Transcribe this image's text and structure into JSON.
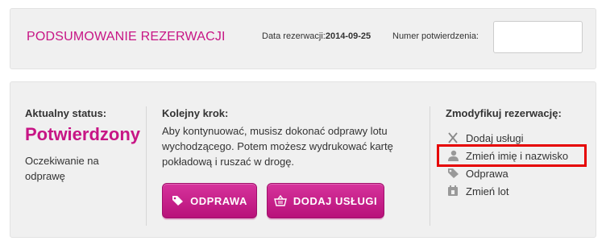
{
  "summary": {
    "title": "PODSUMOWANIE REZERWACJI",
    "date_label": "Data rezerwacji:",
    "date_value": "2014-09-25",
    "confirmation_label": "Numer potwierdzenia:",
    "confirmation_value": ""
  },
  "status": {
    "heading": "Aktualny status:",
    "value": "Potwierdzony",
    "description": "Oczekiwanie na odprawę"
  },
  "next_step": {
    "heading": "Kolejny krok:",
    "text": "Aby kontynuować, musisz dokonać odprawy lotu wychodzącego. Potem możesz wydrukować kartę pokładową i ruszać w drogę.",
    "checkin_label": "ODPRAWA",
    "add_services_label": "DODAJ USŁUGI"
  },
  "modify": {
    "heading": "Zmodyfikuj rezerwację:",
    "items": [
      {
        "label": "Dodaj usługi",
        "icon": "fork-knife-icon"
      },
      {
        "label": "Zmień imię i nazwisko",
        "icon": "person-icon"
      },
      {
        "label": "Odprawa",
        "icon": "tag-icon"
      },
      {
        "label": "Zmień lot",
        "icon": "calendar-icon"
      }
    ]
  },
  "colors": {
    "accent": "#c71585",
    "highlight": "#e60000",
    "panel_bg": "#f0f0f0"
  }
}
